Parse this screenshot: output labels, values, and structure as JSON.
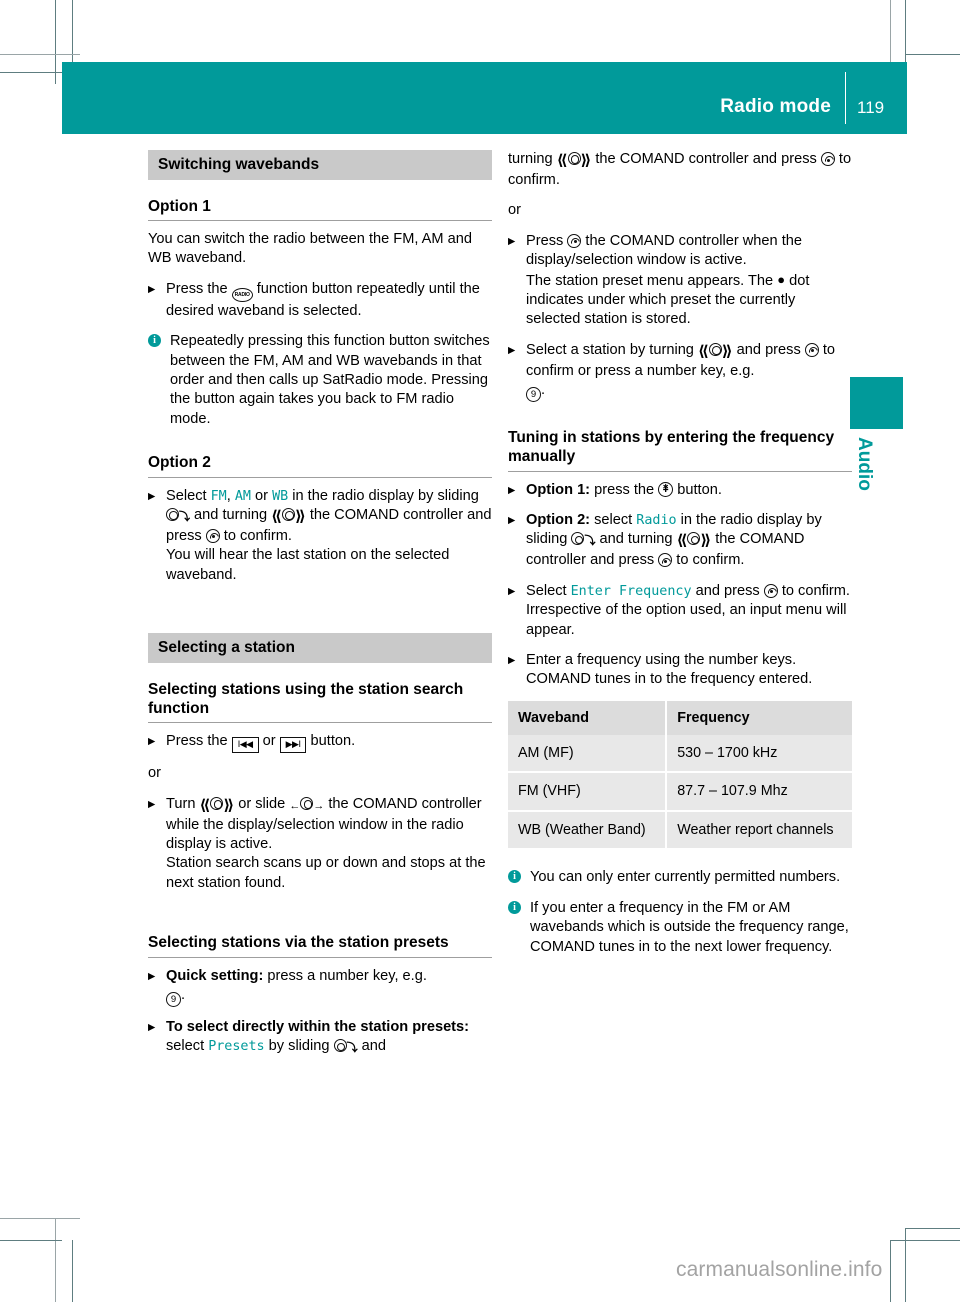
{
  "header": {
    "title": "Radio mode",
    "page_number": "119",
    "side_tab": "Audio",
    "accent_color": "#019a9a"
  },
  "watermark": "carmanualsonline.info",
  "left_column": {
    "section_1": {
      "banner": "Switching wavebands",
      "option_1_heading": "Option 1",
      "intro": "You can switch the radio between the FM, AM and WB waveband.",
      "step_1_a": "Press the ",
      "step_1_b": " function button repeatedly until the desired waveband is selected.",
      "note_1": "Repeatedly pressing this function button switches between the FM, AM and WB wavebands in that order and then calls up SatRadio mode. Pressing the button again takes you back to FM radio mode.",
      "option_2_heading": "Option 2",
      "opt2_a": "Select ",
      "opt2_fm": "FM",
      "opt2_comma": ", ",
      "opt2_am": "AM",
      "opt2_or": " or ",
      "opt2_wb": "WB",
      "opt2_b": " in the radio display by sliding ",
      "opt2_c": " and turning ",
      "opt2_d": " the COMAND controller and press ",
      "opt2_e": " to confirm.",
      "opt2_result": "You will hear the last station on the selected waveband."
    },
    "section_2": {
      "banner": "Selecting a station",
      "sub_1": "Selecting stations using the station search function",
      "press_a": "Press the ",
      "press_or": " or ",
      "press_b": " button.",
      "skip_back_label": "I◀◀",
      "skip_fwd_label": "▶▶I",
      "or": "or",
      "turn_a": "Turn ",
      "turn_b": " or slide ",
      "turn_c": " the COMAND controller while the display/selection window in the radio display is active.",
      "turn_result": "Station search scans up or down and stops at the next station found.",
      "sub_2": "Selecting stations via the station presets",
      "quick_label": "Quick setting:",
      "quick_text": " press a number key, e.g.",
      "quick_key": "9",
      "quick_period": ".",
      "direct_label": "To select directly within the station presets:",
      "direct_a": " select ",
      "direct_presets": "Presets",
      "direct_b": " by sliding ",
      "direct_c": " and"
    }
  },
  "right_column": {
    "cont_a": "turning ",
    "cont_b": " the COMAND controller and press ",
    "cont_c": " to confirm.",
    "or": "or",
    "press_a": "Press ",
    "press_b": " the COMAND controller when the display/selection window is active.",
    "press_result_a": "The station preset menu appears. The ",
    "press_result_dot": "●",
    "press_result_b": " dot indicates under which preset the currently selected station is stored.",
    "select_a": "Select a station by turning ",
    "select_b": " and press ",
    "select_c": " to confirm or press a number key, e.g.",
    "select_key": "9",
    "select_period": ".",
    "tuning_heading": "Tuning in stations by entering the frequency manually",
    "option_1_label": "Option 1:",
    "option_1_a": " press the ",
    "option_1_b": " button.",
    "option_2_label": "Option 2:",
    "option_2_a": " select ",
    "option_2_radio": "Radio",
    "option_2_b": " in the radio display by sliding ",
    "option_2_c": " and turning ",
    "option_2_d": " the COMAND controller and press ",
    "option_2_e": " to confirm.",
    "select_ef_a": "Select ",
    "select_ef_term": "Enter Frequency",
    "select_ef_b": " and press ",
    "select_ef_c": " to confirm.",
    "select_ef_result": "Irrespective of the option used, an input menu will appear.",
    "enter_freq": "Enter a frequency using the number keys.",
    "enter_freq_result": "COMAND tunes in to the frequency entered.",
    "note_1": "You can only enter currently permitted numbers.",
    "note_2": "If you enter a frequency in the FM or AM wavebands which is outside the frequency range, COMAND tunes in to the next lower frequency."
  },
  "frequency_table": {
    "headers": [
      "Waveband",
      "Frequency"
    ],
    "rows": [
      [
        "AM (MF)",
        "530 – 1700 kHz"
      ],
      [
        "FM (VHF)",
        "87.7 – 107.9 Mhz"
      ],
      [
        "WB (Weather Band)",
        "Weather report channels"
      ]
    ]
  }
}
